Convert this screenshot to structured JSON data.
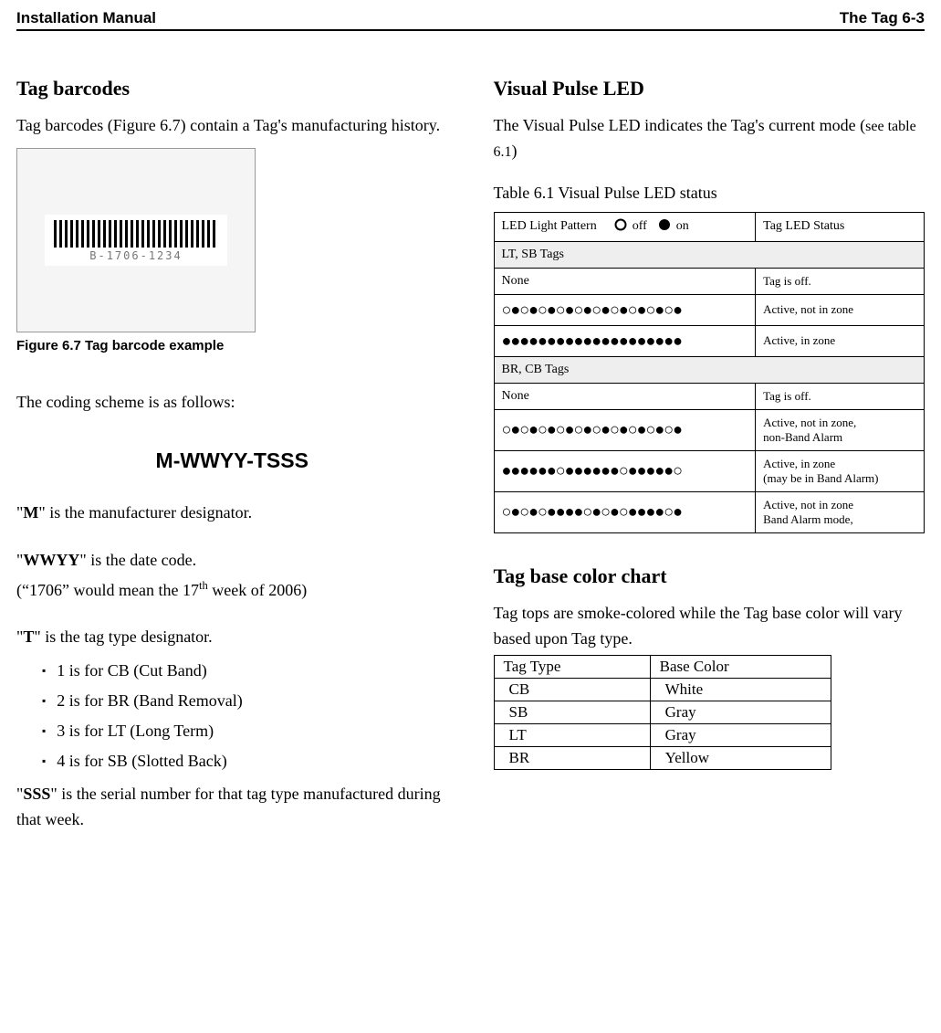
{
  "header": {
    "left": "Installation Manual",
    "right": "The Tag 6-3"
  },
  "left": {
    "barcodes_heading": "Tag barcodes",
    "barcodes_text": "Tag barcodes (Figure 6.7) contain a Tag's manufacturing history.",
    "barcode_sample": "B-1706-1234",
    "fig_caption": "Figure 6.7 Tag barcode example",
    "coding_intro": "The coding scheme is as follows:",
    "coding_scheme": "M-WWYY-TSSS",
    "m_prefix": "\"",
    "m_bold": "M",
    "m_rest": "\" is the manufacturer designator.",
    "wwyy_prefix": "\"",
    "wwyy_bold": "WWYY",
    "wwyy_rest": "\" is the date code.",
    "wwyy_example": "(\"1706\" would mean the 17th week of 2006)",
    "t_prefix": "\"",
    "t_bold": "T",
    "t_rest": "\" is the tag type designator.",
    "t_items": [
      "1 is for CB (Cut Band)",
      "2 is for BR (Band Removal)",
      "3 is for LT (Long Term)",
      "4 is for SB (Slotted Back)"
    ],
    "sss_prefix": "\"",
    "sss_bold": "SSS",
    "sss_rest": "\" is the serial number for that tag type manufactured during that week."
  },
  "right": {
    "led_heading": "Visual Pulse LED",
    "led_text_1": "The Visual Pulse LED indicates the Tag's current mode (",
    "led_text_see": "see table 6.1",
    "led_text_2": ")",
    "table_caption": "Table 6.1 Visual Pulse LED status",
    "led_header_pattern": "LED Light Pattern",
    "led_header_off": "off",
    "led_header_on": "on",
    "led_header_status": "Tag LED Status",
    "group1": "LT, SB Tags",
    "row_none1_pattern": "None",
    "row_none1_status": "Tag is off.",
    "row_lt_alt_pattern": "○●○●○●○●○●○●○●○●○●○●",
    "row_lt_alt_status": "Active, not in zone",
    "row_lt_on_pattern": "●●●●●●●●●●●●●●●●●●●●",
    "row_lt_on_status": "Active, in zone",
    "group2": "BR, CB Tags",
    "row_none2_pattern": "None",
    "row_none2_status": "Tag is off.",
    "row_br_alt_pattern": "○●○●○●○●○●○●○●○●○●○●",
    "row_br_alt_status_l1": "Active, not in zone,",
    "row_br_alt_status_l2": "non-Band Alarm",
    "row_br_in_pattern": "●●●●●●○●●●●●●○●●●●●○",
    "row_br_in_status_l1": "Active, in zone",
    "row_br_in_status_l2": "(may be in Band Alarm)",
    "row_br_band_pattern": "○●○●○●●●●○●○●○●●●●○●",
    "row_br_band_status_l1": "Active, not in zone",
    "row_br_band_status_l2": "Band Alarm mode,",
    "color_heading": "Tag base color chart",
    "color_text": "Tag tops are smoke-colored while the Tag base color will vary based upon Tag type.",
    "color_header_type": "Tag Type",
    "color_header_base": "Base Color",
    "color_rows": [
      {
        "type": "CB",
        "base": "White"
      },
      {
        "type": "SB",
        "base": "Gray"
      },
      {
        "type": "LT",
        "base": "Gray"
      },
      {
        "type": "BR",
        "base": "Yellow"
      }
    ]
  },
  "chart_data": [
    {
      "type": "table",
      "title": "Table 6.1 Visual Pulse LED status",
      "legend": {
        "off": "○",
        "on": "●"
      },
      "groups": [
        {
          "group": "LT, SB Tags",
          "rows": [
            {
              "pattern": "None",
              "status": "Tag is off."
            },
            {
              "pattern": "○●○●○●○●○●○●○●○●○●○●",
              "status": "Active, not in zone"
            },
            {
              "pattern": "●●●●●●●●●●●●●●●●●●●●",
              "status": "Active, in zone"
            }
          ]
        },
        {
          "group": "BR, CB Tags",
          "rows": [
            {
              "pattern": "None",
              "status": "Tag is off."
            },
            {
              "pattern": "○●○●○●○●○●○●○●○●○●○●",
              "status": "Active, not in zone, non-Band Alarm"
            },
            {
              "pattern": "●●●●●●○●●●●●●○●●●●●○",
              "status": "Active, in zone (may be in Band Alarm)"
            },
            {
              "pattern": "○●○●○●●●●○●○●○●●●●○●",
              "status": "Active, not in zone Band Alarm mode,"
            }
          ]
        }
      ]
    },
    {
      "type": "table",
      "title": "Tag base color chart",
      "columns": [
        "Tag Type",
        "Base Color"
      ],
      "rows": [
        [
          "CB",
          "White"
        ],
        [
          "SB",
          "Gray"
        ],
        [
          "LT",
          "Gray"
        ],
        [
          "BR",
          "Yellow"
        ]
      ]
    }
  ]
}
